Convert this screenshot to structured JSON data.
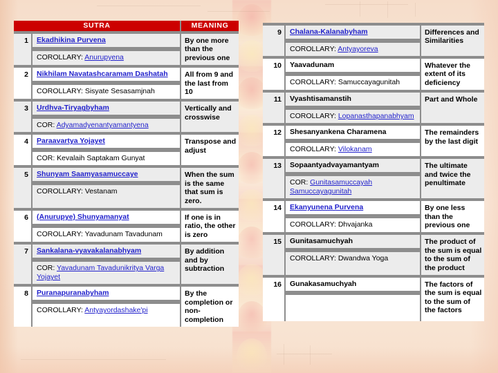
{
  "theme": {
    "header_bg": "#cc0000",
    "header_text": "#ffffff",
    "grid": "#8d8d8d",
    "link": "#2222cc",
    "row_shade": "#ececec",
    "row_alt": "#ffffff",
    "page_bg": "#f7e2d2"
  },
  "left_table": {
    "headers": {
      "number": "",
      "sutra": "SUTRA",
      "meaning": "MEANING"
    },
    "rows": [
      {
        "number": "1",
        "sutra": "Ekadhikina Purvena",
        "sutra_is_link": true,
        "corollary_label": "COROLLARY:",
        "corollary_value": "Anurupyena",
        "corollary_is_link": true,
        "meaning": "By one more than the previous one"
      },
      {
        "number": "2",
        "sutra": "Nikhilam Navatashcaramam Dashatah",
        "sutra_is_link": true,
        "corollary_label": "COROLLARY:",
        "corollary_value": "Sisyate Sesasamjnah",
        "corollary_is_link": false,
        "meaning": "All from 9 and the last from 10"
      },
      {
        "number": "3",
        "sutra": "Urdhva-Tiryagbyham",
        "sutra_is_link": true,
        "corollary_label": "COR:",
        "corollary_value": "Adyamadyenantyamantyena",
        "corollary_is_link": true,
        "meaning": "Vertically and crosswise"
      },
      {
        "number": "4",
        "sutra": "Paraavartya Yojayet",
        "sutra_is_link": true,
        "corollary_label": "COR:",
        "corollary_value": "Kevalaih Saptakam Gunyat",
        "corollary_is_link": false,
        "meaning": "Transpose and adjust"
      },
      {
        "number": "5",
        "sutra": "Shunyam Saamyasamuccaye",
        "sutra_is_link": true,
        "corollary_label": "COROLLARY:",
        "corollary_value": "Vestanam",
        "corollary_is_link": false,
        "meaning": "When the sum is the same that sum is zero."
      },
      {
        "number": "6",
        "sutra": "(Anurupye) Shunyamanyat",
        "sutra_is_link": true,
        "corollary_label": "COROLLARY:",
        "corollary_value": "Yavadunam Tavadunam",
        "corollary_is_link": false,
        "meaning": "If one is in ratio, the other is zero"
      },
      {
        "number": "7",
        "sutra": "Sankalana-vyavakalanabhyam",
        "sutra_is_link": true,
        "corollary_label": "COR:",
        "corollary_value": "Yavadunam Tavadunikritya Varga Yojayet",
        "corollary_is_link": true,
        "meaning": "By addition and by subtraction"
      },
      {
        "number": "8",
        "sutra": "Puranapuranabyham",
        "sutra_is_link": true,
        "corollary_label": "COROLLARY:",
        "corollary_value": "Antyayordashake'pi",
        "corollary_is_link": true,
        "meaning": "By the completion or non-completion"
      }
    ]
  },
  "right_table": {
    "rows": [
      {
        "number": "9",
        "sutra": "Chalana-Kalanabyham",
        "sutra_is_link": true,
        "corollary_label": "COROLLARY:",
        "corollary_value": "Antyayoreva",
        "corollary_is_link": true,
        "meaning": "Differences and Similarities"
      },
      {
        "number": "10",
        "sutra": "Yaavadunam",
        "sutra_is_link": false,
        "corollary_label": "COROLLARY:",
        "corollary_value": "Samuccayagunitah",
        "corollary_is_link": false,
        "meaning": "Whatever the extent of its deficiency"
      },
      {
        "number": "11",
        "sutra": "Vyashtisamanstih",
        "sutra_is_link": false,
        "corollary_label": "COROLLARY:",
        "corollary_value": "Lopanasthapanabhyam",
        "corollary_is_link": true,
        "meaning": "Part and Whole"
      },
      {
        "number": "12",
        "sutra": "Shesanyankena Charamena",
        "sutra_is_link": false,
        "corollary_label": "COROLLARY:",
        "corollary_value": "Vilokanam",
        "corollary_is_link": true,
        "meaning": "The remainders by the last digit"
      },
      {
        "number": "13",
        "sutra": "Sopaantyadvayamantyam",
        "sutra_is_link": false,
        "corollary_label": "COR:",
        "corollary_value": "Gunitasamuccayah Samuccayagunitah",
        "corollary_is_link": true,
        "meaning": "The ultimate and twice the penultimate"
      },
      {
        "number": "14",
        "sutra": "Ekanyunena Purvena",
        "sutra_is_link": true,
        "corollary_label": "COROLLARY:",
        "corollary_value": "Dhvajanka",
        "corollary_is_link": false,
        "meaning": "By one less than the previous one"
      },
      {
        "number": "15",
        "sutra": "Gunitasamuchyah",
        "sutra_is_link": false,
        "corollary_label": "COROLLARY:",
        "corollary_value": "Dwandwa Yoga",
        "corollary_is_link": false,
        "meaning": "The product of the sum is equal to the sum of the product"
      },
      {
        "number": "16",
        "sutra": "Gunakasamuchyah",
        "sutra_is_link": false,
        "corollary_label": "",
        "corollary_value": "",
        "corollary_is_link": false,
        "meaning": "The factors of the sum is equal to the sum of the factors"
      }
    ]
  }
}
